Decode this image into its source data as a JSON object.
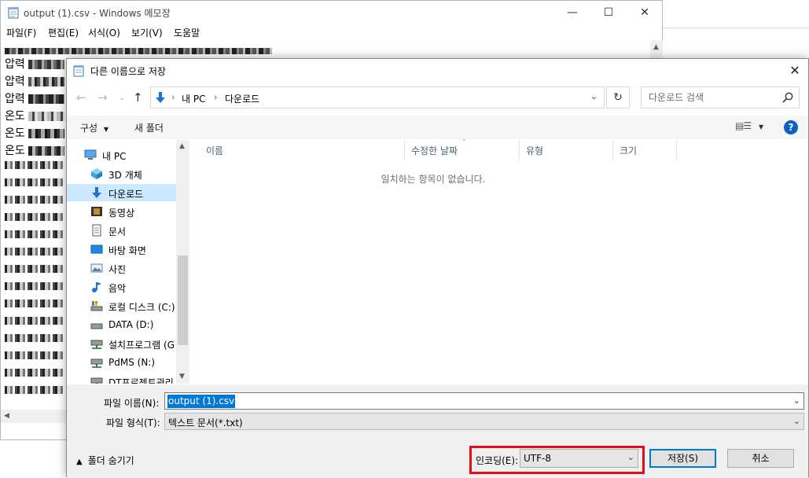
{
  "notepad": {
    "title": "output (1).csv - Windows 메모장",
    "menu": [
      "파일(F)",
      "편집(E)",
      "서식(O)",
      "보기(V)",
      "도움말"
    ],
    "visible_line_prefixes": [
      "압력",
      "압력",
      "압력",
      "온도",
      "온도",
      "온도"
    ]
  },
  "dialog": {
    "title": "다른 이름으로 저장",
    "address": {
      "crumbs": [
        "내 PC",
        "다운로드"
      ]
    },
    "search_placeholder": "다운로드 검색",
    "toolbar": {
      "organize": "구성",
      "new_folder": "새 폴더"
    },
    "tree": [
      {
        "label": "내 PC",
        "icon": "pc-icon",
        "selected": false
      },
      {
        "label": "3D 개체",
        "icon": "cube-3d-icon",
        "selected": false
      },
      {
        "label": "다운로드",
        "icon": "download-arrow-icon",
        "selected": true
      },
      {
        "label": "동영상",
        "icon": "film-icon",
        "selected": false
      },
      {
        "label": "문서",
        "icon": "document-icon",
        "selected": false
      },
      {
        "label": "바탕 화면",
        "icon": "desktop-icon",
        "selected": false
      },
      {
        "label": "사진",
        "icon": "picture-icon",
        "selected": false
      },
      {
        "label": "음악",
        "icon": "music-note-icon",
        "selected": false
      },
      {
        "label": "로컬 디스크 (C:)",
        "icon": "system-drive-icon",
        "selected": false
      },
      {
        "label": "DATA (D:)",
        "icon": "drive-icon",
        "selected": false
      },
      {
        "label": "설치프로그램 (G",
        "icon": "network-drive-icon",
        "selected": false
      },
      {
        "label": "PdMS (N:)",
        "icon": "network-drive-icon",
        "selected": false
      },
      {
        "label": "DT프로젝트관리",
        "icon": "network-drive-icon",
        "selected": false
      }
    ],
    "columns": [
      "이름",
      "수정한 날짜",
      "유형",
      "크기"
    ],
    "empty_message": "일치하는 항목이 없습니다.",
    "filename_label": "파일 이름(N):",
    "filename_value": "output (1).csv",
    "filetype_label": "파일 형식(T):",
    "filetype_value": "텍스트 문서(*.txt)",
    "hide_folders": "폴더 숨기기",
    "encoding_label": "인코딩(E):",
    "encoding_value": "UTF-8",
    "save_label": "저장(S)",
    "cancel_label": "취소",
    "colors": {
      "accent": "#0078d7",
      "highlight_box": "#e0101a",
      "selected_item": "#cce8ff"
    }
  }
}
